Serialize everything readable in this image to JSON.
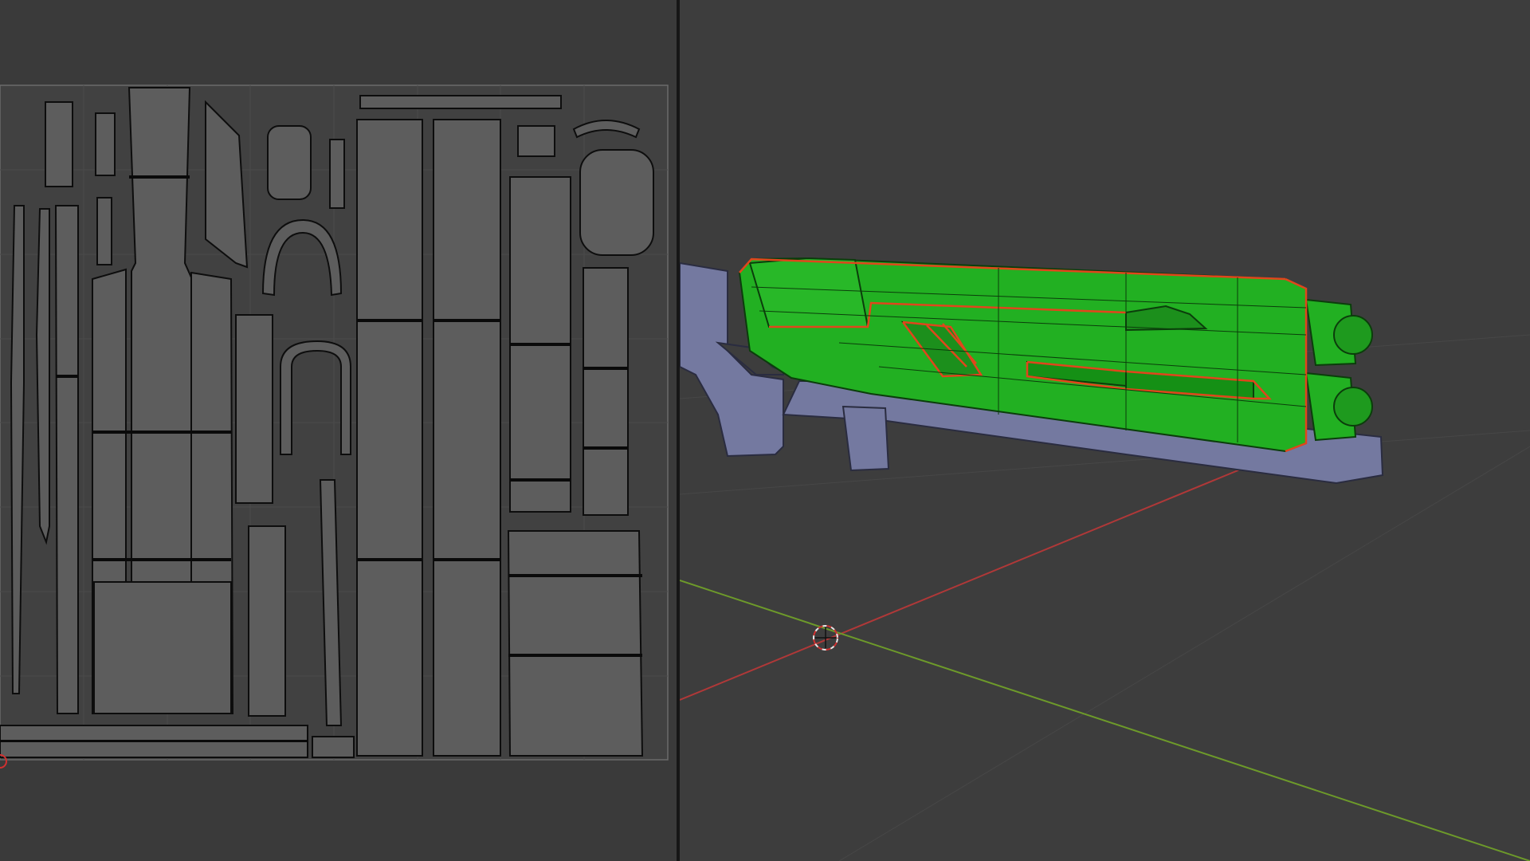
{
  "layout": {
    "left_panel": "uv-editor",
    "right_panel": "3d-viewport"
  },
  "colors": {
    "uv_background": "#3a3a3a",
    "uv_tile": "#444444",
    "uv_island_fill": "#5a5a5a",
    "uv_island_edge": "#0d0d0d",
    "uv_grid": "#4a4a4a",
    "viewport_background": "#3d3d3d",
    "mesh_selected": "#22b022",
    "mesh_selected_edge": "#0b3d0b",
    "mesh_unselected": "#7479a0",
    "seam": "#e0461c",
    "axis_x": "#b03838",
    "axis_y": "#6d9a2a",
    "panel_divider": "#161616"
  },
  "viewport": {
    "selection_mode": "faces",
    "cursor_icon": "3d-cursor-icon"
  },
  "uv_editor": {
    "cursor_icon": "2d-cursor-icon"
  }
}
